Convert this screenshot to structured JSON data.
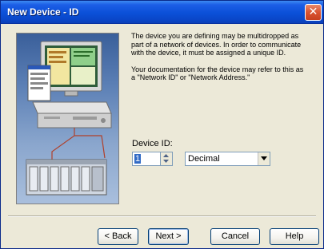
{
  "window": {
    "title": "New Device - ID",
    "close_glyph": "✕"
  },
  "illustration": {
    "icon": "computer-and-network-devices-illustration"
  },
  "info": {
    "paragraph1": "The device you are defining may be multidropped as part of a network of devices.  In order to communicate with the device, it must be assigned a unique ID.",
    "paragraph2": "Your documentation for the device may refer to this as a \"Network ID\" or \"Network Address.\""
  },
  "device_id": {
    "label": "Device ID:",
    "value": "1",
    "radix": "Decimal"
  },
  "buttons": {
    "back": "< Back",
    "next": "Next >",
    "cancel": "Cancel",
    "help": "Help"
  },
  "colors": {
    "titlebar": "#0b50d8",
    "dialog_bg": "#ece9d8",
    "close_button": "#d95331"
  }
}
